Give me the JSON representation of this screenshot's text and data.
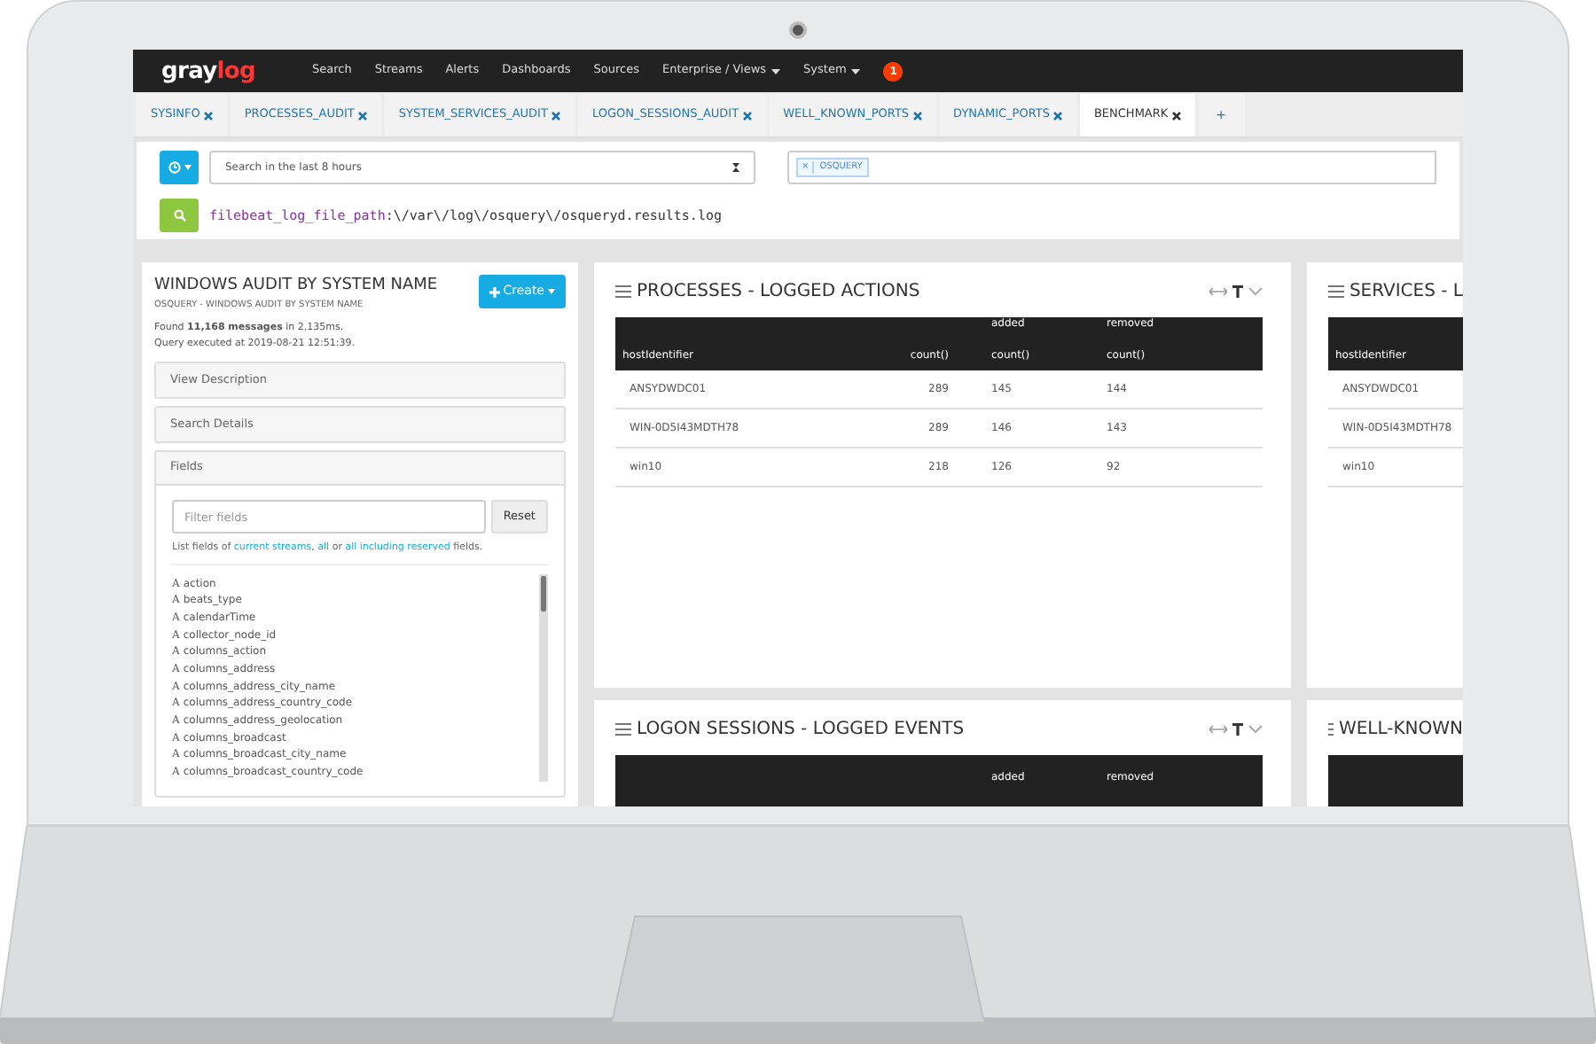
{
  "nav": {
    "logo_main": "gray",
    "logo_accent": "log",
    "items": [
      {
        "label": "Search",
        "dropdown": false
      },
      {
        "label": "Streams",
        "dropdown": false
      },
      {
        "label": "Alerts",
        "dropdown": false
      },
      {
        "label": "Dashboards",
        "dropdown": false
      },
      {
        "label": "Sources",
        "dropdown": false
      },
      {
        "label": "Enterprise / Views",
        "dropdown": true
      },
      {
        "label": "System",
        "dropdown": true
      }
    ],
    "badge": "1"
  },
  "tabs": [
    {
      "label": "SYSINFO",
      "selected": false
    },
    {
      "label": "PROCESSES_AUDIT",
      "selected": false
    },
    {
      "label": "SYSTEM_SERVICES_AUDIT",
      "selected": false
    },
    {
      "label": "LOGON_SESSIONS_AUDIT",
      "selected": false
    },
    {
      "label": "WELL_KNOWN_PORTS",
      "selected": false
    },
    {
      "label": "DYNAMIC_PORTS",
      "selected": false
    },
    {
      "label": "BENCHMARK",
      "selected": true
    }
  ],
  "add_tab": "+",
  "search": {
    "range": "Search in the last 8 hours",
    "stream_remove": "×",
    "stream": "OSQUERY",
    "query_field": "filebeat_log_file_path",
    "query_value": ":\\/var\\/log\\/osquery\\/osqueryd.results.log"
  },
  "sidebar": {
    "title": "WINDOWS AUDIT BY SYSTEM NAME",
    "subtitle": "OSQUERY - WINDOWS AUDIT BY SYSTEM NAME",
    "create": "Create",
    "found": "Found **11,168 messages** in 2,135ms.",
    "executed": "Query executed at 2019-08-21 12:51:39.",
    "sections": [
      {
        "label": "View Description",
        "expanded": false
      },
      {
        "label": "Search Details",
        "expanded": false
      },
      {
        "label": "Fields",
        "expanded": true
      }
    ],
    "filter_placeholder": "Filter fields",
    "reset": "Reset",
    "hint": [
      {
        "text": "List fields of ",
        "link": false
      },
      {
        "text": "current streams",
        "link": true
      },
      {
        "text": ", ",
        "link": false
      },
      {
        "text": "all",
        "link": true
      },
      {
        "text": " or ",
        "link": false
      },
      {
        "text": "all including reserved",
        "link": true
      },
      {
        "text": " fields.",
        "link": false
      }
    ],
    "fields": [
      {
        "icon": "A",
        "name": "action"
      },
      {
        "icon": "A",
        "name": "beats_type"
      },
      {
        "icon": "A",
        "name": "calendarTime"
      },
      {
        "icon": "A",
        "name": "collector_node_id"
      },
      {
        "icon": "A",
        "name": "columns_action"
      },
      {
        "icon": "A",
        "name": "columns_address"
      },
      {
        "icon": "A",
        "name": "columns_address_city_name"
      },
      {
        "icon": "A",
        "name": "columns_address_country_code"
      },
      {
        "icon": "A",
        "name": "columns_address_geolocation"
      },
      {
        "icon": "A",
        "name": "columns_broadcast"
      },
      {
        "icon": "A",
        "name": "columns_broadcast_city_name"
      },
      {
        "icon": "A",
        "name": "columns_broadcast_country_code"
      }
    ]
  },
  "widgets": [
    {
      "title": "PROCESSES - LOGGED ACTIONS",
      "columns": [
        {
          "kind": "data",
          "label": "hostIdentifier"
        },
        {
          "kind": "data",
          "label": "count()"
        },
        {
          "kind": "data",
          "group": "added",
          "label": "count()"
        },
        {
          "kind": "data",
          "group": "removed",
          "label": "count()"
        }
      ],
      "rows": [
        [
          "ANSYDWDC01",
          "289",
          "145",
          "144"
        ],
        [
          "WIN-0D5I43MDTH78",
          "289",
          "146",
          "143"
        ],
        [
          "win10",
          "218",
          "126",
          "92"
        ]
      ]
    },
    {
      "title": "SERVICES - L",
      "columns": [
        {
          "kind": "data",
          "label": "hostIdentifier"
        }
      ],
      "rows": [
        [
          "ANSYDWDC01"
        ],
        [
          "WIN-0D5I43MDTH78"
        ],
        [
          "win10"
        ]
      ]
    },
    {
      "title": "LOGON SESSIONS - LOGGED EVENTS",
      "columns": [
        {
          "kind": "blank"
        },
        {
          "kind": "blank"
        },
        {
          "kind": "data",
          "group": "added"
        },
        {
          "kind": "data",
          "group": "removed"
        }
      ]
    },
    {
      "title": "WELL-KNOWN",
      "columns": [
        {
          "kind": "blank"
        }
      ]
    }
  ]
}
